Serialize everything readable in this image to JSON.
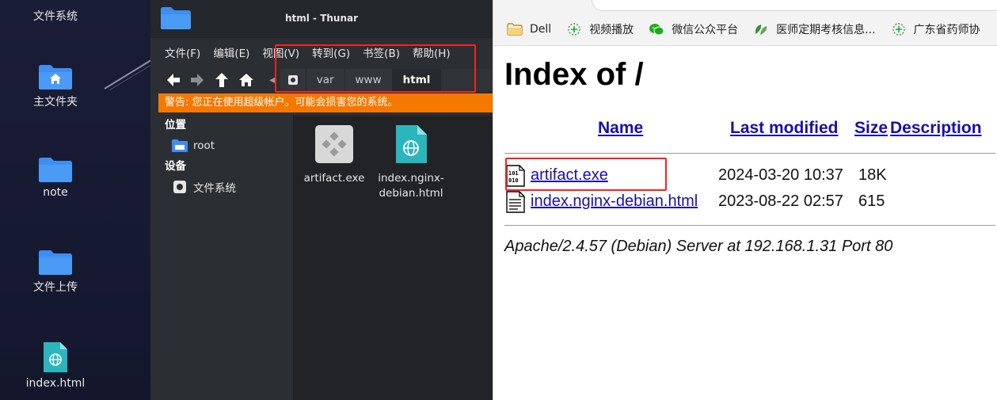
{
  "desktop": {
    "icons": [
      {
        "label": "文件系统",
        "icon": "hard-drive-icon"
      },
      {
        "label": "主文件夹",
        "icon": "home-folder-icon"
      },
      {
        "label": "note",
        "icon": "folder-icon"
      },
      {
        "label": "文件上传",
        "icon": "folder-icon"
      },
      {
        "label": "index.html",
        "icon": "html-file-icon"
      }
    ]
  },
  "thunar": {
    "title": "html - Thunar",
    "menu": [
      "文件(F)",
      "编辑(E)",
      "视图(V)",
      "转到(G)",
      "书签(B)",
      "帮助(H)"
    ],
    "path": [
      "var",
      "www",
      "html"
    ],
    "warning": "警告: 您正在使用超级帐户。可能会损害您的系统。",
    "sidebar": {
      "places_heading": "位置",
      "places": [
        {
          "label": "root",
          "icon": "folder-icon"
        }
      ],
      "devices_heading": "设备",
      "devices": [
        {
          "label": "文件系统",
          "icon": "hard-drive-icon"
        }
      ]
    },
    "files": [
      {
        "name": "artifact.exe",
        "icon": "executable-icon"
      },
      {
        "name": "index.nginx-debian.html",
        "name_line1": "index.nginx-",
        "name_line2": "debian.html",
        "icon": "html-file-icon"
      }
    ]
  },
  "browser": {
    "bookmarks": [
      {
        "label": "Dell",
        "icon": "folder-icon"
      },
      {
        "label": "视频播放",
        "icon": "bookmark-icon"
      },
      {
        "label": "微信公众平台",
        "icon": "wechat-icon"
      },
      {
        "label": "医师定期考核信息...",
        "icon": "leaf-icon"
      },
      {
        "label": "广东省药师协",
        "icon": "bookmark-icon"
      }
    ],
    "page": {
      "heading": "Index of /",
      "columns": {
        "name": "Name",
        "modified": "Last modified",
        "size": "Size",
        "description": "Description"
      },
      "rows": [
        {
          "name": "artifact.exe",
          "modified": "2024-03-20 10:37",
          "size": "18K",
          "icon": "binary-file-icon"
        },
        {
          "name": "index.nginx-debian.html",
          "modified": "2023-08-22 02:57",
          "size": "615",
          "icon": "text-file-icon"
        }
      ],
      "footer": "Apache/2.4.57 (Debian) Server at 192.168.1.31 Port 80"
    }
  },
  "colors": {
    "warning_bg": "#f57900",
    "highlight": "#ff1f1f",
    "link": "#1a0dab",
    "folder_blue": "#3d8ef2",
    "html_teal": "#2bb5bd"
  }
}
